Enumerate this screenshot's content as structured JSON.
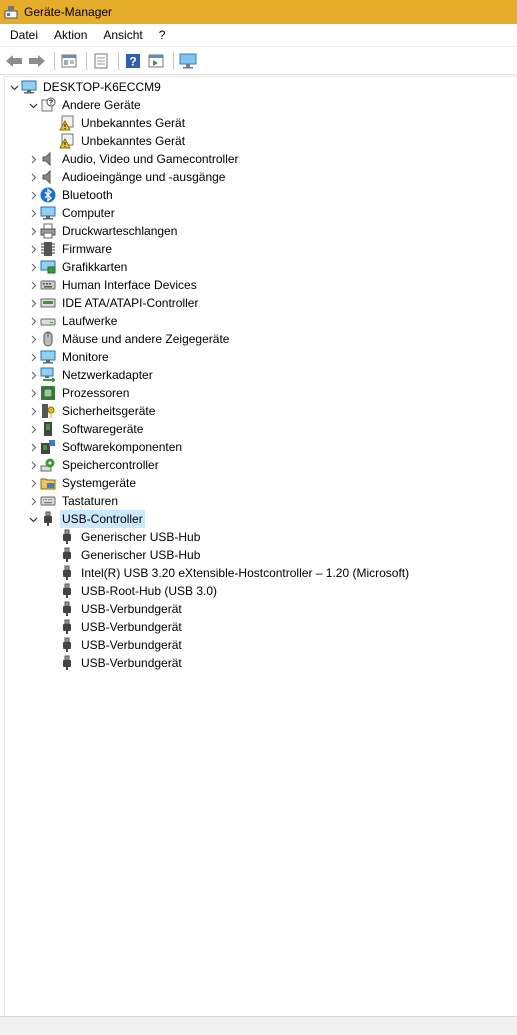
{
  "window": {
    "title": "Geräte-Manager"
  },
  "menu": [
    "Datei",
    "Aktion",
    "Ansicht",
    "?"
  ],
  "toolbar": [
    {
      "name": "back-arrow-icon"
    },
    {
      "name": "forward-arrow-icon"
    },
    {
      "name": "properties-icon"
    },
    {
      "name": "show-hidden-icon"
    },
    {
      "name": "help-icon"
    },
    {
      "name": "action-pane-icon"
    },
    {
      "name": "monitor-scan-icon"
    }
  ],
  "tree": {
    "root": "DESKTOP-K6ECCM9",
    "items": [
      {
        "label": "DESKTOP-K6ECCM9",
        "level": 0,
        "expander": "open",
        "icon": "computer-icon"
      },
      {
        "label": "Andere Geräte",
        "level": 1,
        "expander": "open",
        "icon": "unknown-device-icon"
      },
      {
        "label": "Unbekanntes Gerät",
        "level": 2,
        "expander": "none",
        "icon": "warning-device-icon"
      },
      {
        "label": "Unbekanntes Gerät",
        "level": 2,
        "expander": "none",
        "icon": "warning-device-icon"
      },
      {
        "label": "Audio, Video und Gamecontroller",
        "level": 1,
        "expander": "closed",
        "icon": "speaker-icon"
      },
      {
        "label": "Audioeingänge und -ausgänge",
        "level": 1,
        "expander": "closed",
        "icon": "speaker-icon"
      },
      {
        "label": "Bluetooth",
        "level": 1,
        "expander": "closed",
        "icon": "bluetooth-icon"
      },
      {
        "label": "Computer",
        "level": 1,
        "expander": "closed",
        "icon": "monitor-icon"
      },
      {
        "label": "Druckwarteschlangen",
        "level": 1,
        "expander": "closed",
        "icon": "printer-icon"
      },
      {
        "label": "Firmware",
        "level": 1,
        "expander": "closed",
        "icon": "firmware-icon"
      },
      {
        "label": "Grafikkarten",
        "level": 1,
        "expander": "closed",
        "icon": "display-adapter-icon"
      },
      {
        "label": "Human Interface Devices",
        "level": 1,
        "expander": "closed",
        "icon": "hid-icon"
      },
      {
        "label": "IDE ATA/ATAPI-Controller",
        "level": 1,
        "expander": "closed",
        "icon": "ide-icon"
      },
      {
        "label": "Laufwerke",
        "level": 1,
        "expander": "closed",
        "icon": "drive-icon"
      },
      {
        "label": "Mäuse und andere Zeigegeräte",
        "level": 1,
        "expander": "closed",
        "icon": "mouse-icon"
      },
      {
        "label": "Monitore",
        "level": 1,
        "expander": "closed",
        "icon": "monitor-icon"
      },
      {
        "label": "Netzwerkadapter",
        "level": 1,
        "expander": "closed",
        "icon": "network-icon"
      },
      {
        "label": "Prozessoren",
        "level": 1,
        "expander": "closed",
        "icon": "processor-icon"
      },
      {
        "label": "Sicherheitsgeräte",
        "level": 1,
        "expander": "closed",
        "icon": "security-key-icon"
      },
      {
        "label": "Softwaregeräte",
        "level": 1,
        "expander": "closed",
        "icon": "software-device-icon"
      },
      {
        "label": "Softwarekomponenten",
        "level": 1,
        "expander": "closed",
        "icon": "software-component-icon"
      },
      {
        "label": "Speichercontroller",
        "level": 1,
        "expander": "closed",
        "icon": "storage-controller-icon"
      },
      {
        "label": "Systemgeräte",
        "level": 1,
        "expander": "closed",
        "icon": "system-folder-icon"
      },
      {
        "label": "Tastaturen",
        "level": 1,
        "expander": "closed",
        "icon": "keyboard-icon"
      },
      {
        "label": "USB-Controller",
        "level": 1,
        "expander": "open",
        "icon": "usb-icon",
        "selected": true
      },
      {
        "label": "Generischer USB-Hub",
        "level": 2,
        "expander": "none",
        "icon": "usb-icon"
      },
      {
        "label": "Generischer USB-Hub",
        "level": 2,
        "expander": "none",
        "icon": "usb-icon"
      },
      {
        "label": "Intel(R) USB 3.20 eXtensible-Hostcontroller – 1.20 (Microsoft)",
        "level": 2,
        "expander": "none",
        "icon": "usb-icon"
      },
      {
        "label": "USB-Root-Hub (USB 3.0)",
        "level": 2,
        "expander": "none",
        "icon": "usb-icon"
      },
      {
        "label": "USB-Verbundgerät",
        "level": 2,
        "expander": "none",
        "icon": "usb-icon"
      },
      {
        "label": "USB-Verbundgerät",
        "level": 2,
        "expander": "none",
        "icon": "usb-icon"
      },
      {
        "label": "USB-Verbundgerät",
        "level": 2,
        "expander": "none",
        "icon": "usb-icon"
      },
      {
        "label": "USB-Verbundgerät",
        "level": 2,
        "expander": "none",
        "icon": "usb-icon"
      }
    ]
  },
  "colors": {
    "titlebar": "#e6ac2b",
    "selection": "#cce8ff"
  }
}
